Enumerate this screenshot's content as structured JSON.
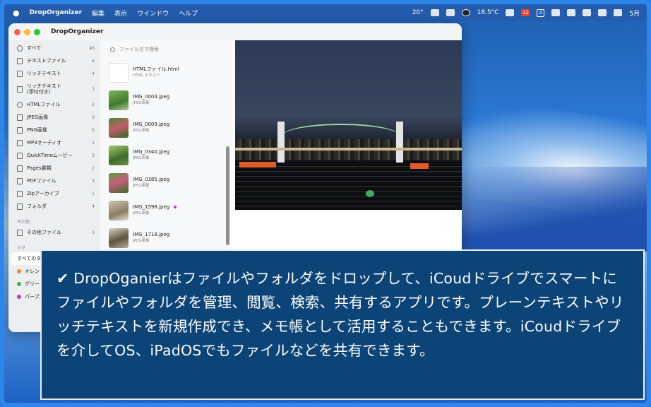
{
  "menubar": {
    "apple": "",
    "app_name": "DropOrganizer",
    "menus": [
      "編集",
      "表示",
      "ウインドウ",
      "ヘルプ"
    ],
    "weather_left": "20°",
    "weather_right": "18.5°C",
    "calendar_day": "12",
    "input_mode": "A",
    "date": "5月"
  },
  "window": {
    "title": "DropOrganizer"
  },
  "sidebar": {
    "items": [
      {
        "label": "すべて",
        "count": "46",
        "icon": "all-icon"
      },
      {
        "label": "テキストファイル",
        "count": "6",
        "icon": "document-icon"
      },
      {
        "label": "リッチテキスト",
        "count": "4",
        "icon": "document-icon"
      },
      {
        "label": "リッチテキスト\n(添付付き)",
        "count": "3",
        "icon": "document-icon"
      },
      {
        "label": "HTMLファイル",
        "count": "2",
        "icon": "globe-icon"
      },
      {
        "label": "JPEG画像",
        "count": "9",
        "icon": "image-icon"
      },
      {
        "label": "PNG画像",
        "count": "6",
        "icon": "image-icon"
      },
      {
        "label": "MP3オーディオ",
        "count": "2",
        "icon": "audio-icon"
      },
      {
        "label": "QuickTimeムービー",
        "count": "3",
        "icon": "movie-icon"
      },
      {
        "label": "Pages書類",
        "count": "2",
        "icon": "document-icon"
      },
      {
        "label": "PDFファイル",
        "count": "3",
        "icon": "pdf-icon"
      },
      {
        "label": "Zipアーカイブ",
        "count": "1",
        "icon": "archive-icon"
      },
      {
        "label": "フォルダ",
        "count": "4",
        "icon": "folder-icon"
      }
    ],
    "other_section": "その他",
    "other_item": {
      "label": "その他ファイル",
      "count": "3"
    },
    "tag_section": "タグ",
    "tags": [
      {
        "label": "すべてのタ",
        "color": ""
      },
      {
        "label": "オレンジ",
        "color": "#f08a24"
      },
      {
        "label": "グリーン",
        "color": "#3fb24a"
      },
      {
        "label": "パープル",
        "color": "#b63ad0"
      }
    ]
  },
  "filelist": {
    "search_placeholder": "ファイル名で検索",
    "files": [
      {
        "name": "HTMLファイル.html",
        "type": "HTML テキスト"
      },
      {
        "name": "IMG_0004.jpeg",
        "type": "JPEG画像"
      },
      {
        "name": "IMG_0009.jpeg",
        "type": "JPEG画像"
      },
      {
        "name": "IMG_0340.jpeg",
        "type": "JPEG画像"
      },
      {
        "name": "IMG_0385.jpeg",
        "type": "JPEG画像"
      },
      {
        "name": "IMG_1598.jpeg",
        "type": "JPEG画像"
      },
      {
        "name": "IMG_1718.jpeg",
        "type": "JPEG画像"
      }
    ]
  },
  "callout": {
    "text": "✔ DropOganierはファイルやフォルダをドロップして、iCoudドライブでスマートにファイルやフォルダを管理、閲覧、検索、共有するアプリです。プレーンテキストやリッチテキストを新規作成でき、メモ帳として活用することもできます。iCoudドライブを介してOS、iPadOSでもファイルなどを共有できます。"
  },
  "colors": {
    "callout_bg": "#0c4478",
    "tag_purple": "#b63ad0"
  }
}
